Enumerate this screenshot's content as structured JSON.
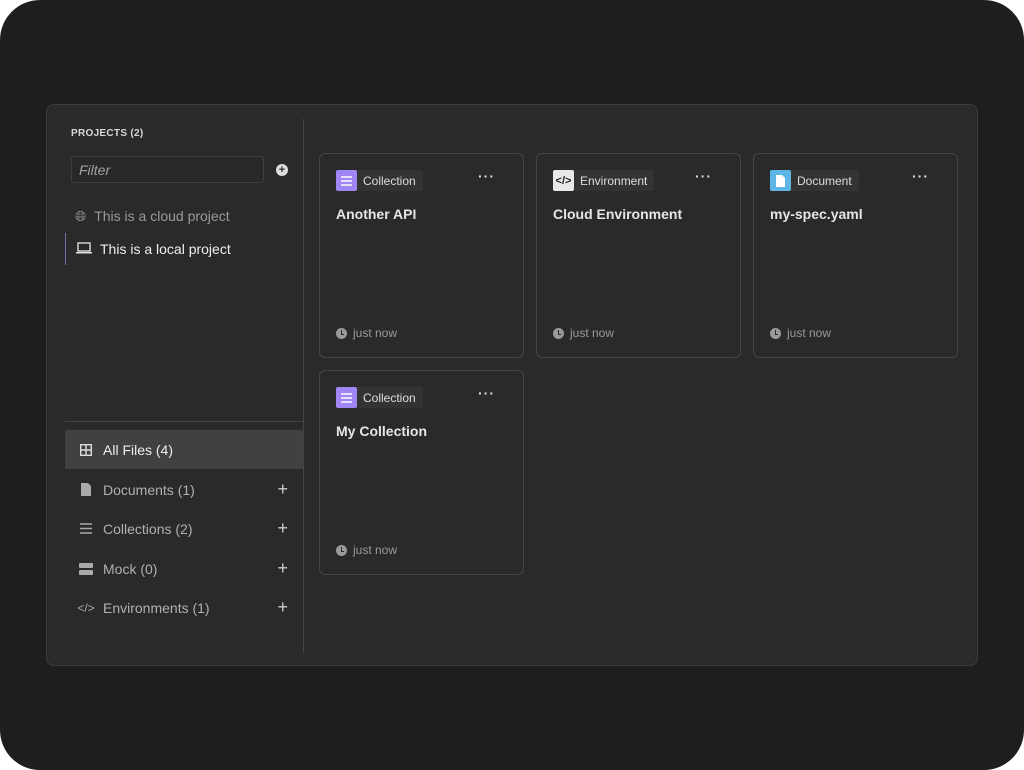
{
  "sidebar": {
    "projects_title": "PROJECTS (2)",
    "filter_placeholder": "Filter",
    "projects": [
      {
        "label": "This is a cloud project",
        "icon": "globe-icon",
        "active": false
      },
      {
        "label": "This is a local project",
        "icon": "laptop-icon",
        "active": true
      }
    ],
    "nav": [
      {
        "label": "All Files (4)",
        "icon": "grid-icon",
        "active": true
      },
      {
        "label": "Documents (1)",
        "icon": "document-icon"
      },
      {
        "label": "Collections (2)",
        "icon": "list-icon"
      },
      {
        "label": "Mock (0)",
        "icon": "server-icon"
      },
      {
        "label": "Environments (1)",
        "icon": "code-icon"
      }
    ]
  },
  "cards": [
    {
      "type": "Collection",
      "title": "Another API",
      "time": "just now",
      "icon": "collection-icon",
      "color": "#9f85f5"
    },
    {
      "type": "Environment",
      "title": "Cloud Environment",
      "time": "just now",
      "icon": "code-icon",
      "color": "#e8e8e8"
    },
    {
      "type": "Document",
      "title": "my-spec.yaml",
      "time": "just now",
      "icon": "document-icon",
      "color": "#5fb6e6"
    },
    {
      "type": "Collection",
      "title": "My Collection",
      "time": "just now",
      "icon": "collection-icon",
      "color": "#9f85f5"
    }
  ],
  "more_label": "···"
}
